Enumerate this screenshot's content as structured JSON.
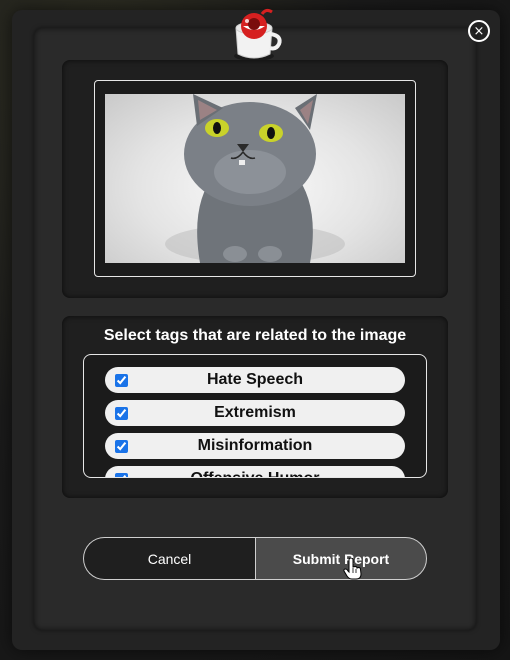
{
  "modal": {
    "close_symbol": "×",
    "logo_icon": "report-mascot-mug-icon"
  },
  "image_preview": {
    "subject": "gray cat looking up"
  },
  "tags": {
    "title": "Select tags that are related to the image",
    "items": [
      {
        "label": "Hate Speech",
        "checked": true
      },
      {
        "label": "Extremism",
        "checked": true
      },
      {
        "label": "Misinformation",
        "checked": true
      },
      {
        "label": "Offensive Humor",
        "checked": true
      }
    ]
  },
  "actions": {
    "cancel_label": "Cancel",
    "submit_label": "Submit Report"
  },
  "colors": {
    "modal_bg": "#232323",
    "panel_bg": "#1f1f1f",
    "submit_bg": "#4b4b4b",
    "checkbox_accent": "#1a73e8"
  }
}
